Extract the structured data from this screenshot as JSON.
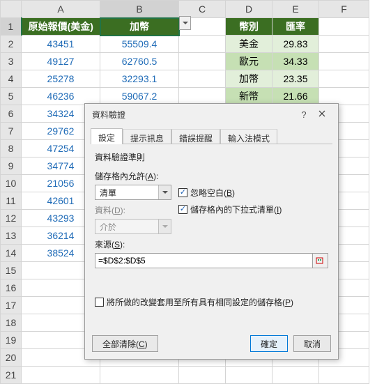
{
  "columns": [
    "A",
    "B",
    "C",
    "D",
    "E",
    "F"
  ],
  "hdr": {
    "a": "原始報價(美金)",
    "b": "加幣",
    "d": "幣別",
    "e": "匯率"
  },
  "rowsAB": [
    [
      "43451",
      "55509.4"
    ],
    [
      "49127",
      "62760.5"
    ],
    [
      "25278",
      "32293.1"
    ],
    [
      "46236",
      "59067.2"
    ],
    [
      "34324",
      ""
    ],
    [
      "29762",
      ""
    ],
    [
      "47254",
      ""
    ],
    [
      "34774",
      ""
    ],
    [
      "21056",
      ""
    ],
    [
      "42601",
      ""
    ],
    [
      "43293",
      ""
    ],
    [
      "36214",
      ""
    ],
    [
      "38524",
      ""
    ]
  ],
  "lookup": [
    [
      "美金",
      "29.83"
    ],
    [
      "歐元",
      "34.33"
    ],
    [
      "加幣",
      "23.35"
    ],
    [
      "新幣",
      "21.66"
    ]
  ],
  "dialog": {
    "title": "資料驗證",
    "help": "?",
    "tabs": [
      "設定",
      "提示訊息",
      "錯誤提醒",
      "輸入法模式"
    ],
    "group": "資料驗證準則",
    "allow_lbl": "儲存格內允許(A):",
    "allow_val": "清單",
    "ignore_blank": "忽略空白(B)",
    "dropdown_chk": "儲存格內的下拉式清單(I)",
    "data_lbl": "資料(D):",
    "data_val": "介於",
    "source_lbl": "來源(S):",
    "source_val": "=$D$2:$D$5",
    "apply_all": "將所做的改變套用至所有具有相同設定的儲存格(P)",
    "clear": "全部清除(C)",
    "ok": "確定",
    "cancel": "取消"
  }
}
